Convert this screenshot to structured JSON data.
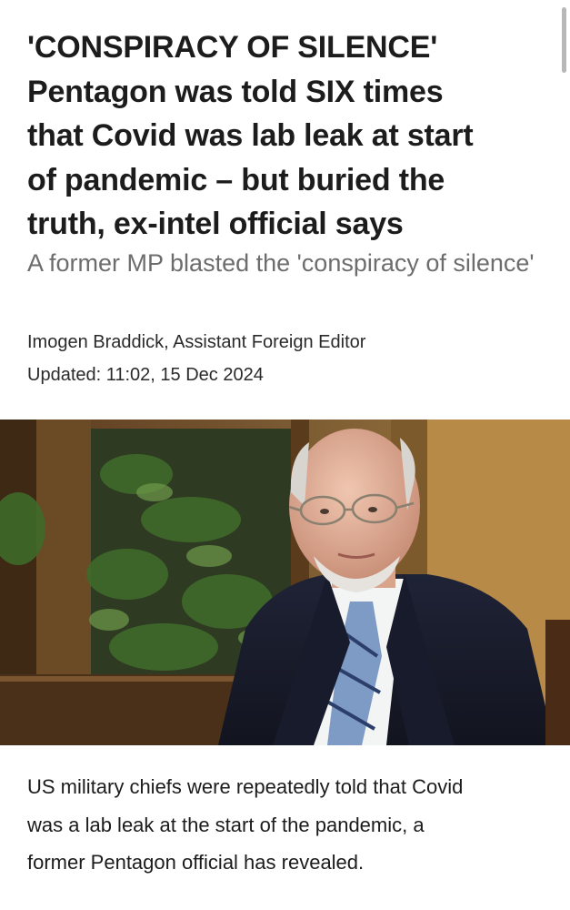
{
  "article": {
    "headline_lines": [
      "'CONSPIRACY OF SILENCE'",
      "Pentagon was told SIX times",
      "that Covid was lab leak at start",
      "of pandemic – but buried the",
      "truth, ex-intel official says"
    ],
    "standfirst": "A former MP blasted the 'conspiracy of silence'",
    "byline": "Imogen Braddick, Assistant Foreign Editor",
    "updated": "Updated: 11:02, 15 Dec 2024",
    "image": {
      "subject": "older man with glasses and white goatee in dark suit, blue striped tie, seated before a wooden cabinet with plants"
    },
    "body_lines": [
      "US military chiefs were repeatedly told that Covid",
      "was a lab leak at the start of the pandemic, a",
      "former Pentagon official has revealed."
    ]
  },
  "colors": {
    "headline": "#1c1c1c",
    "standfirst": "#6d6d6d",
    "meta": "#2a2a2a",
    "background": "#ffffff"
  }
}
